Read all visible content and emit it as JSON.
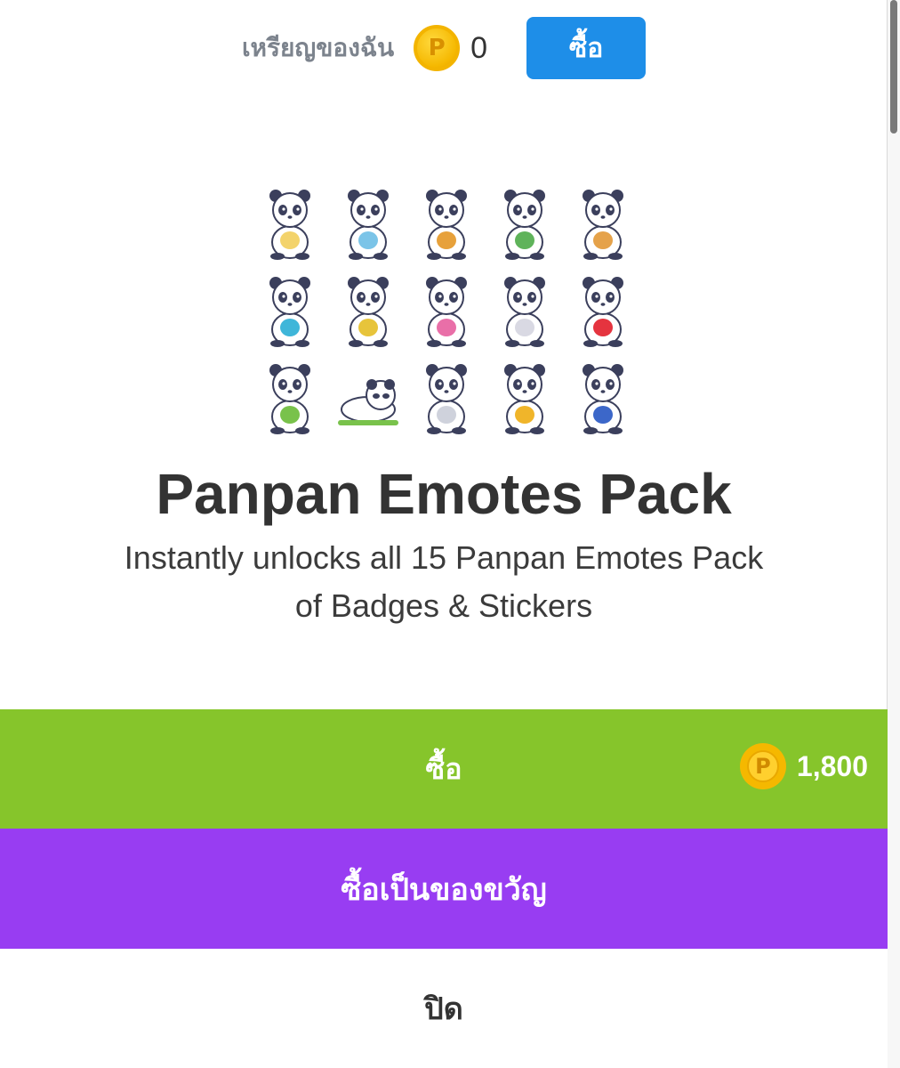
{
  "wallet": {
    "label": "เหรียญของฉัน",
    "coin_symbol": "P",
    "balance": "0",
    "buy_button": "ซื้อ"
  },
  "sticker_grid": {
    "rows": 3,
    "cols": 5,
    "items": [
      "angel-panda-icon",
      "bubble-tea-panda-icon",
      "burger-panda-icon",
      "reading-panda-icon",
      "cookie-panda-icon",
      "sunglasses-panda-icon",
      "dab-panda-icon",
      "donut-panda-icon",
      "shy-panda-icon",
      "heart-panda-icon",
      "bamboo-panda-icon",
      "sleeping-panda-icon",
      "newspaper-panda-icon",
      "trophy-panda-icon",
      "dumbbell-panda-icon"
    ]
  },
  "product": {
    "title": "Panpan Emotes Pack",
    "description_line1": "Instantly unlocks all 15 Panpan Emotes Pack",
    "description_line2": "of Badges & Stickers"
  },
  "actions": {
    "buy_label": "ซื้อ",
    "price": "1,800",
    "gift_label": "ซื้อเป็นของขวัญ",
    "close_label": "ปิด"
  },
  "colors": {
    "buy_bar": "#86c52b",
    "gift_bar": "#983df2",
    "top_buy_button": "#1e8ee8",
    "coin": "#f5b800"
  }
}
